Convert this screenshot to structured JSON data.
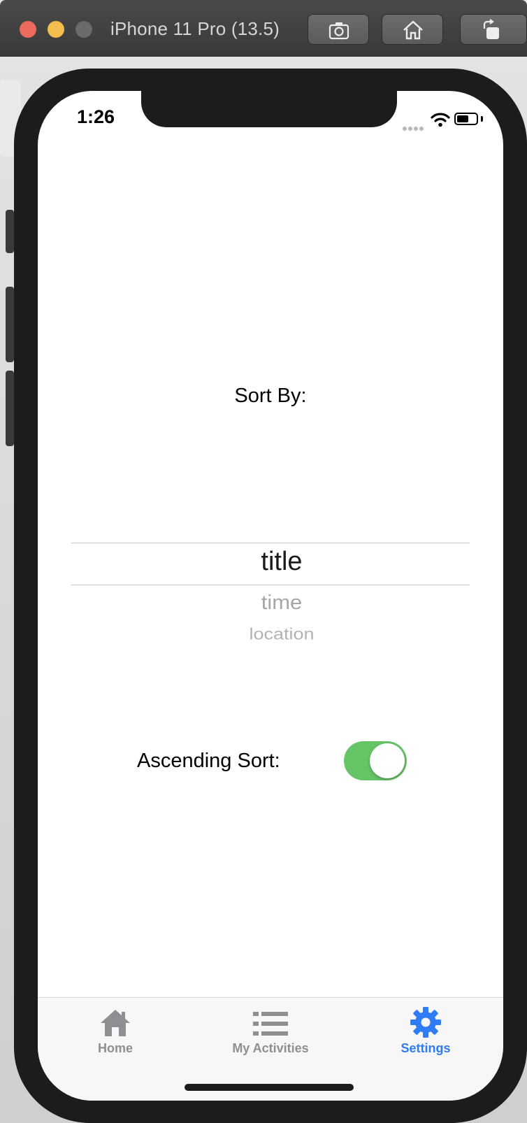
{
  "window": {
    "title": "iPhone 11 Pro (13.5)"
  },
  "toolbar": {
    "screenshot_icon": "camera-icon",
    "home_icon": "home-icon",
    "rotate_icon": "rotate-icon"
  },
  "status_bar": {
    "time": "1:26",
    "wifi_icon": "wifi-icon",
    "battery_icon": "battery-icon",
    "battery_level": 0.6
  },
  "settings": {
    "sort_by_label": "Sort By:",
    "picker_options": [
      "title",
      "time",
      "location"
    ],
    "picker_selected": "title",
    "ascending_label": "Ascending Sort:",
    "ascending_on": true
  },
  "tab_bar": {
    "active_color": "#2f7cf6",
    "inactive_color": "#8e8e93",
    "tabs": [
      {
        "label": "Home",
        "icon": "home-icon",
        "active": false
      },
      {
        "label": "My Activities",
        "icon": "list-icon",
        "active": false
      },
      {
        "label": "Settings",
        "icon": "gear-icon",
        "active": true
      }
    ]
  },
  "colors": {
    "toggle_on": "#65c466"
  }
}
